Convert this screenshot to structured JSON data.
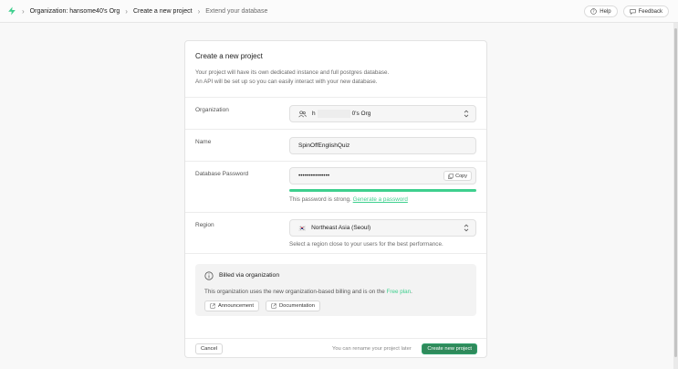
{
  "breadcrumb": {
    "items": [
      {
        "label": "Organization: hansome40's Org"
      },
      {
        "label": "Create a new project"
      },
      {
        "label": "Extend your database"
      }
    ]
  },
  "topbar": {
    "help_label": "Help",
    "feedback_label": "Feedback"
  },
  "card": {
    "title": "Create a new project",
    "description_line1": "Your project will have its own dedicated instance and full postgres database.",
    "description_line2": "An API will be set up so you can easily interact with your new database."
  },
  "form": {
    "organization": {
      "label": "Organization",
      "value_prefix": "h",
      "value_suffix": "0's Org"
    },
    "name": {
      "label": "Name",
      "value": "SpinOffEnglishQuiz"
    },
    "password": {
      "label": "Database Password",
      "value": "•••••••••••••••",
      "copy_label": "Copy",
      "strength_fraction": 1.0,
      "strength_text": "This password is strong.",
      "generate_link": "Generate a password"
    },
    "region": {
      "label": "Region",
      "flag": "🇰🇷",
      "value": "Northeast Asia (Seoul)",
      "hint": "Select a region close to your users for the best performance."
    }
  },
  "billing": {
    "title": "Billed via organization",
    "description": "This organization uses the new organization-based billing and is on the",
    "plan_link": "Free plan",
    "period": ".",
    "announcement_label": "Announcement",
    "documentation_label": "Documentation"
  },
  "footer": {
    "cancel_label": "Cancel",
    "note": "You can rename your project later",
    "create_label": "Create new project"
  },
  "colors": {
    "brand": "#3ecf8e",
    "primary_button": "#2f8a5b"
  }
}
